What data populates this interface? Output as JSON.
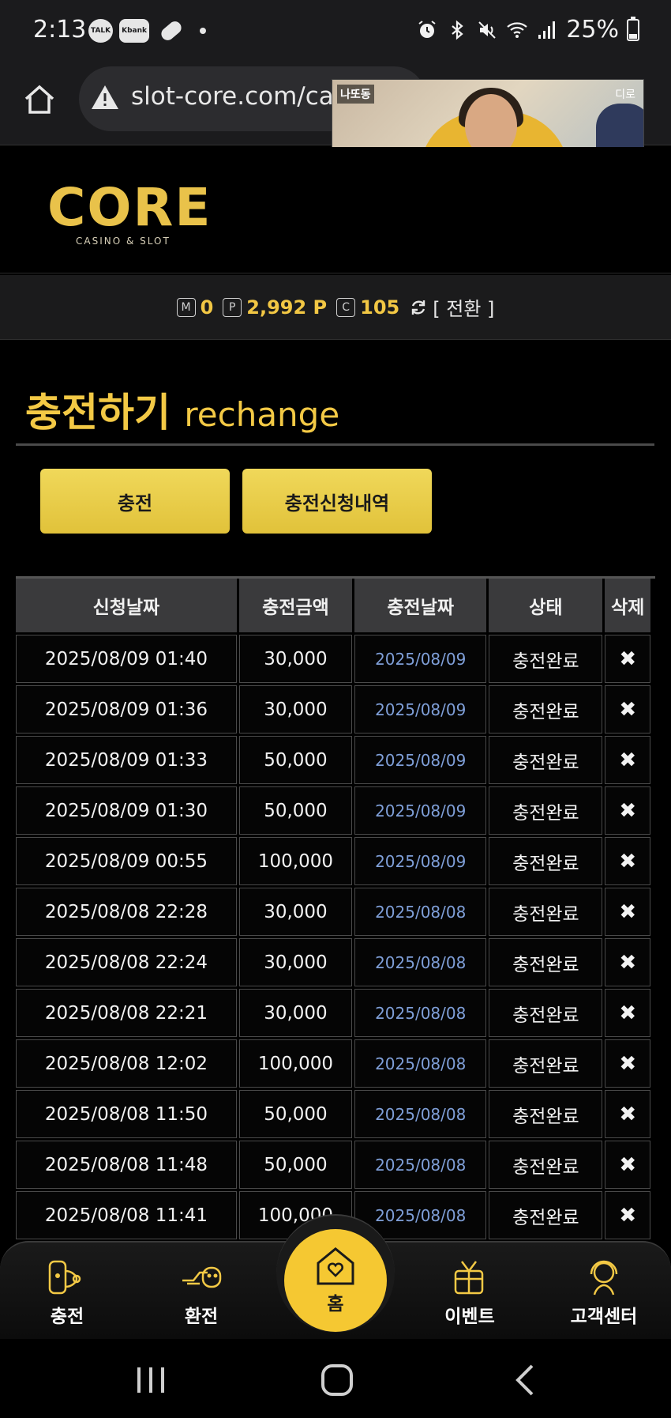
{
  "status_bar": {
    "time": "2:13",
    "chips": [
      "TALK",
      "Kbank"
    ],
    "battery": "25%",
    "battery_level": 0.25
  },
  "browser": {
    "url": "slot-core.com/ca"
  },
  "video_overlay": {
    "tag": "나또동",
    "badge": "디로"
  },
  "site": {
    "logo_main": "CORE",
    "logo_sub": "CASINO & SLOT"
  },
  "balance": {
    "money_label": "M",
    "money_value": "0",
    "point_label": "P",
    "point_value": "2,992 P",
    "coin_label": "C",
    "coin_value": "105",
    "switch_label": "[ 전환 ]"
  },
  "page": {
    "title_ko": "충전하기",
    "title_en": "rechange"
  },
  "buttons": {
    "charge": "충전",
    "history": "충전신청내역"
  },
  "table": {
    "headers": [
      "신청날짜",
      "충전금액",
      "충전날짜",
      "상태",
      "삭제"
    ],
    "delete_symbol": "✖",
    "rows": [
      {
        "requested": "2025/08/09 01:40",
        "amount": "30,000",
        "charged": "2025/08/09",
        "status": "충전완료"
      },
      {
        "requested": "2025/08/09 01:36",
        "amount": "30,000",
        "charged": "2025/08/09",
        "status": "충전완료"
      },
      {
        "requested": "2025/08/09 01:33",
        "amount": "50,000",
        "charged": "2025/08/09",
        "status": "충전완료"
      },
      {
        "requested": "2025/08/09 01:30",
        "amount": "50,000",
        "charged": "2025/08/09",
        "status": "충전완료"
      },
      {
        "requested": "2025/08/09 00:55",
        "amount": "100,000",
        "charged": "2025/08/09",
        "status": "충전완료"
      },
      {
        "requested": "2025/08/08 22:28",
        "amount": "30,000",
        "charged": "2025/08/08",
        "status": "충전완료"
      },
      {
        "requested": "2025/08/08 22:24",
        "amount": "30,000",
        "charged": "2025/08/08",
        "status": "충전완료"
      },
      {
        "requested": "2025/08/08 22:21",
        "amount": "30,000",
        "charged": "2025/08/08",
        "status": "충전완료"
      },
      {
        "requested": "2025/08/08 12:02",
        "amount": "100,000",
        "charged": "2025/08/08",
        "status": "충전완료"
      },
      {
        "requested": "2025/08/08 11:50",
        "amount": "50,000",
        "charged": "2025/08/08",
        "status": "충전완료"
      },
      {
        "requested": "2025/08/08 11:48",
        "amount": "50,000",
        "charged": "2025/08/08",
        "status": "충전완료"
      },
      {
        "requested": "2025/08/08 11:41",
        "amount": "100,000",
        "charged": "2025/08/08",
        "status": "충전완료"
      }
    ]
  },
  "bottom_nav": {
    "charge": "충전",
    "exchange": "환전",
    "home": "홈",
    "event": "이벤트",
    "support": "고객센터"
  },
  "colors": {
    "accent_gold": "#f3c945",
    "button_yellow": "#e8cb45",
    "date_blue": "#7f9fd8"
  }
}
